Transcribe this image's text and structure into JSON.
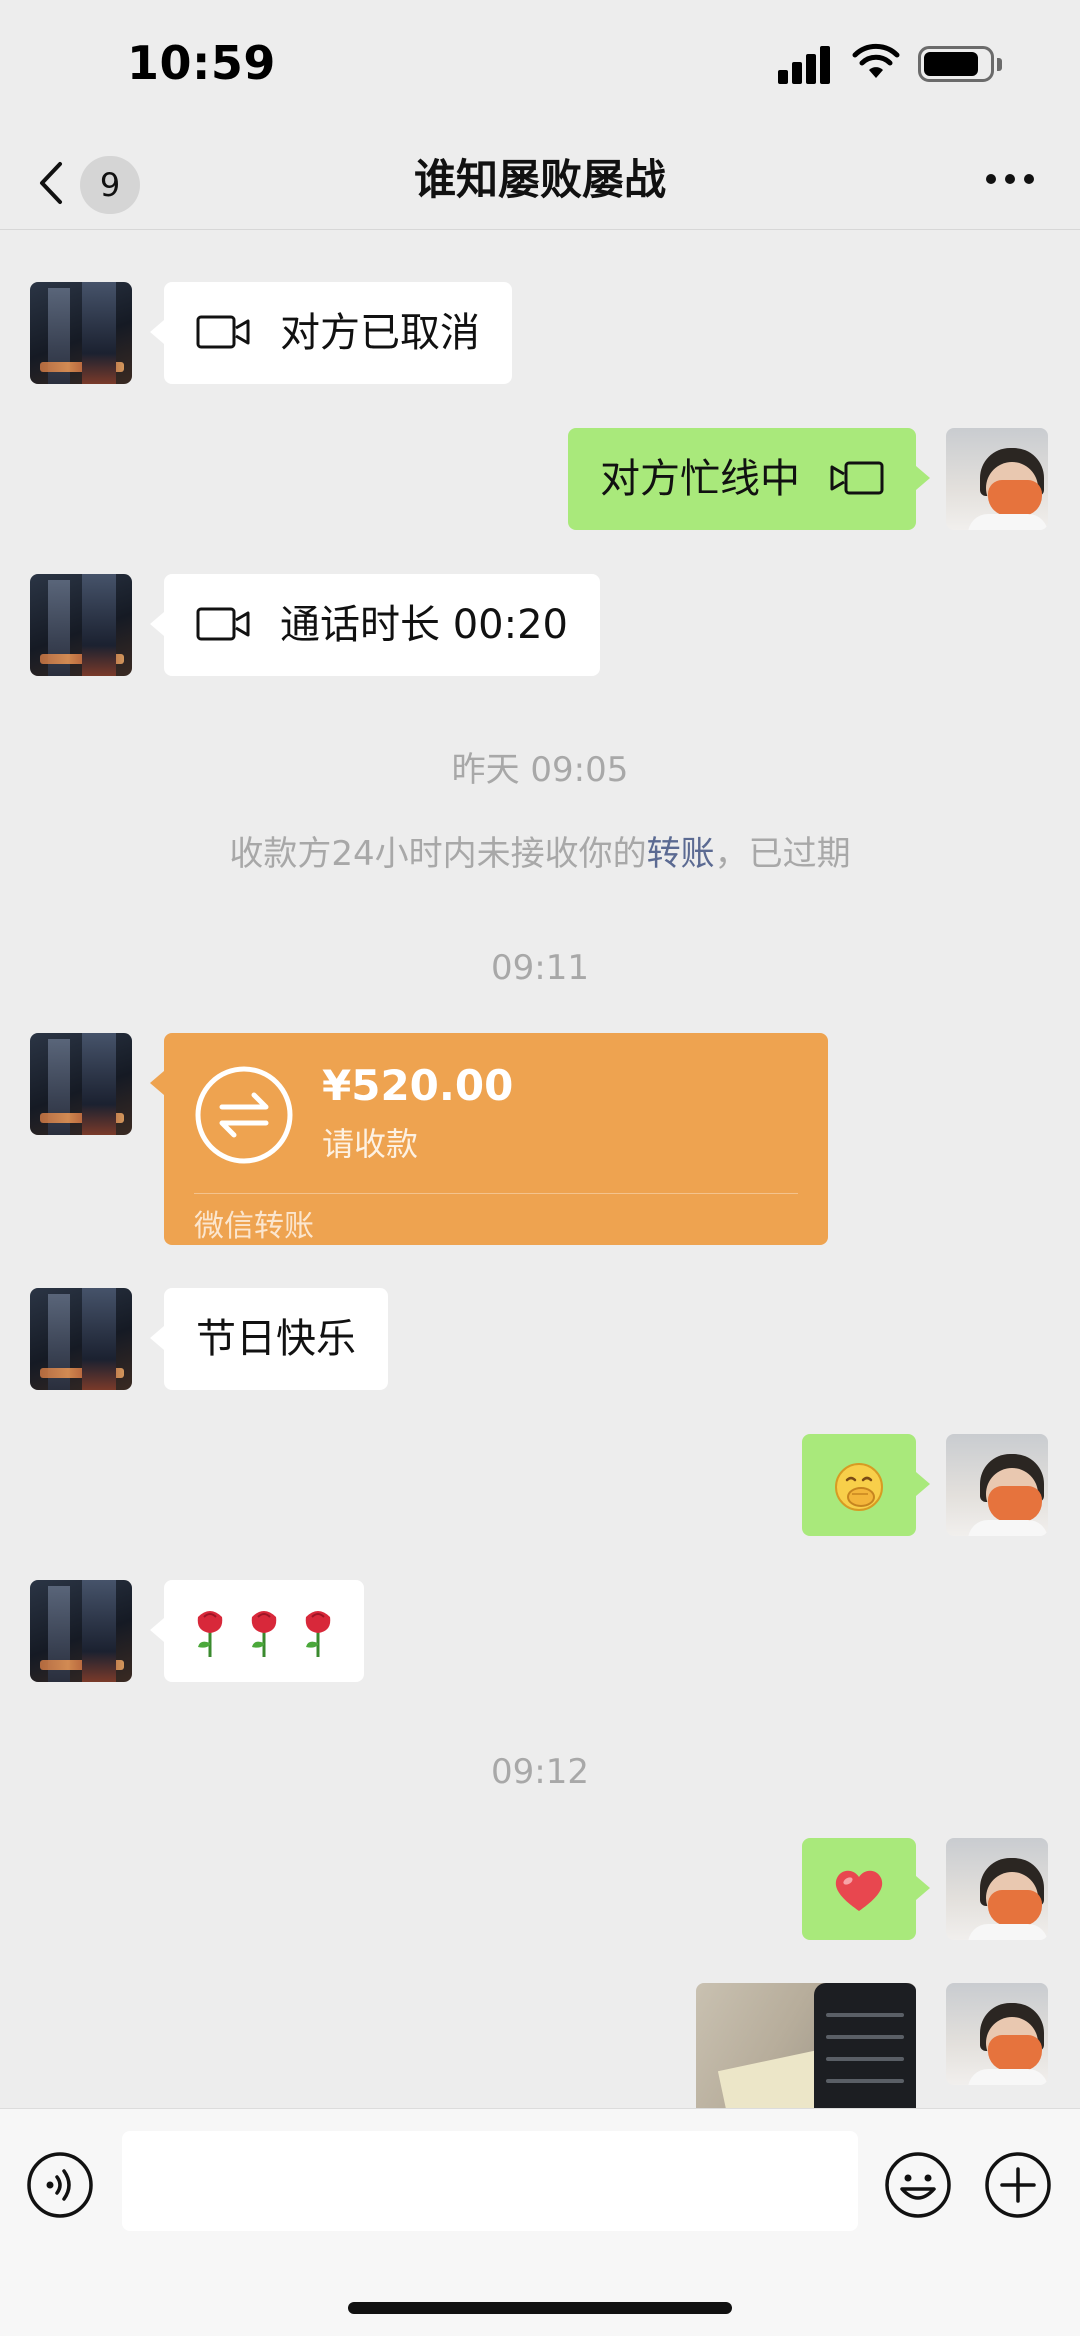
{
  "status_bar": {
    "time": "10:59",
    "battery_level": 0.85
  },
  "nav": {
    "back_badge": "9",
    "title": "谁知屡败屡战"
  },
  "messages": {
    "m1": "对方已取消",
    "m2": "对方忙线中",
    "m3": "通话时长 00:20",
    "ts1": "昨天 09:05",
    "notice_prefix": "收款方24小时内未接收你的",
    "notice_link": "转账",
    "notice_suffix": "，已过期",
    "ts2": "09:11",
    "transfer": {
      "amount": "¥520.00",
      "status": "请收款",
      "footer": "微信转账"
    },
    "m5": "节日快乐",
    "m6_emoji": "🤭",
    "m7_emoji": [
      "🌹",
      "🌹",
      "🌹"
    ],
    "ts3": "09:12",
    "m8_emoji": "❤️"
  },
  "input": {
    "placeholder": ""
  },
  "colors": {
    "background": "#ededed",
    "bubble_self": "#a9e97b",
    "bubble_other": "#ffffff",
    "transfer_card": "#eea350",
    "link": "#5b6a92"
  },
  "icons": [
    "back-chevron-icon",
    "more-icon",
    "video-call-icon",
    "transfer-arrows-icon",
    "voice-icon",
    "emoji-icon",
    "plus-icon"
  ]
}
